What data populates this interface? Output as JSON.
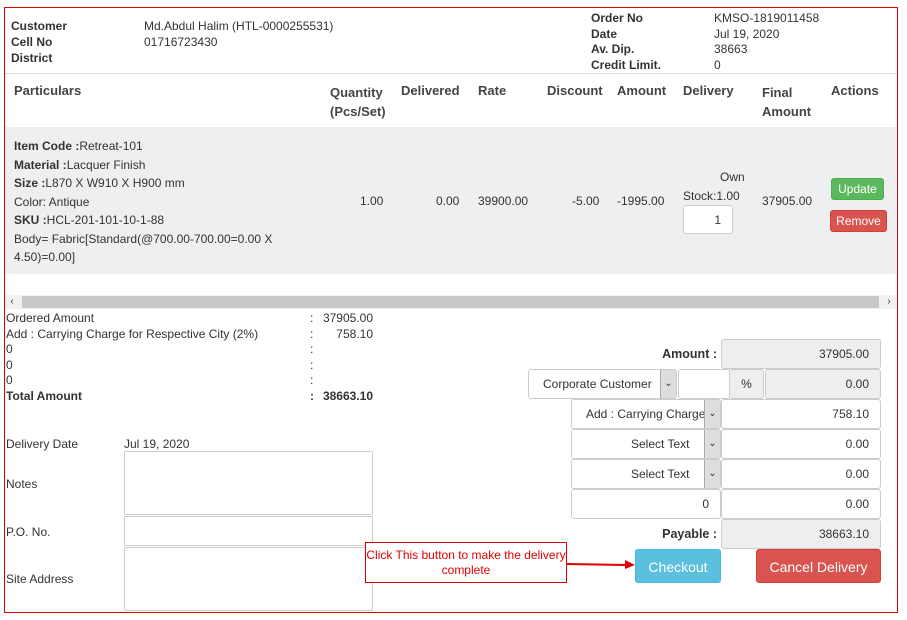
{
  "header": {
    "customer_label": "Customer",
    "customer_value": "Md.Abdul Halim (HTL-0000255531)",
    "cell_label": "Cell No",
    "cell_value": "01716723430",
    "district_label": "District",
    "order_label": "Order No",
    "order_value": "KMSO-1819011458",
    "date_label": "Date",
    "date_value": "Jul 19, 2020",
    "avdip_label": "Av. Dip.",
    "avdip_value": "38663",
    "credit_label": "Credit Limit.",
    "credit_value": "0"
  },
  "table": {
    "columns": [
      "Particulars",
      "Quantity",
      "(Pcs/Set)",
      "Delivered",
      "Rate",
      "Discount",
      "Amount",
      "Delivery",
      "Final",
      "Amount",
      "Actions"
    ],
    "row": {
      "item_code_label": "Item Code :",
      "item_code": "Retreat-101",
      "material_label": "Material :",
      "material": "Lacquer Finish",
      "size_label": "Size :",
      "size": "L870 X W910 X H900 mm",
      "color": "Color: Antique",
      "sku_label": "SKU :",
      "sku": "HCL-201-101-10-1-88",
      "body_line1": "Body= Fabric[Standard(@700.00-700.00=0.00 X",
      "body_line2": "4.50)=0.00]",
      "quantity": "1.00",
      "delivered": "0.00",
      "rate": "39900.00",
      "discount": "-5.00",
      "amount": "-1995.00",
      "own": "Own",
      "stock": "Stock:1.00",
      "delivery_qty": "1",
      "final_amount": "37905.00",
      "update": "Update",
      "remove": "Remove"
    }
  },
  "summary": {
    "rows": [
      {
        "label": "Ordered Amount",
        "value": "37905.00"
      },
      {
        "label": "Add : Carrying Charge for Respective City (2%)",
        "value": "758.10"
      },
      {
        "label": "0",
        "value": ""
      },
      {
        "label": "0",
        "value": ""
      },
      {
        "label": "0",
        "value": ""
      },
      {
        "label": "Total Amount",
        "value": "38663.10"
      }
    ],
    "colon": ":"
  },
  "form": {
    "delivery_date_label": "Delivery Date",
    "delivery_date": "Jul 19, 2020",
    "notes_label": "Notes",
    "po_label": "P.O. No.",
    "site_label": "Site Address"
  },
  "totals": {
    "amount_label": "Amount :",
    "amount": "37905.00",
    "customer_type": "Corporate Customer",
    "pct_symbol": "%",
    "pct_value": "",
    "discount": "0.00",
    "charge1_select": "Add : Carrying Charge",
    "charge1": "758.10",
    "charge2_select": "Select Text",
    "charge2": "0.00",
    "charge3_select": "Select Text",
    "charge3": "0.00",
    "extra_input": "0",
    "extra_value": "0.00",
    "payable_label": "Payable :",
    "payable": "38663.10"
  },
  "actions": {
    "checkout": "Checkout",
    "cancel": "Cancel Delivery"
  },
  "annotation": {
    "text": "Click This button to make the delivery complete"
  },
  "colors": {
    "update": "#5cb85c",
    "remove": "#d9534f",
    "checkout": "#5bc0de",
    "cancel": "#d9534f",
    "annotation": "#e00000"
  }
}
